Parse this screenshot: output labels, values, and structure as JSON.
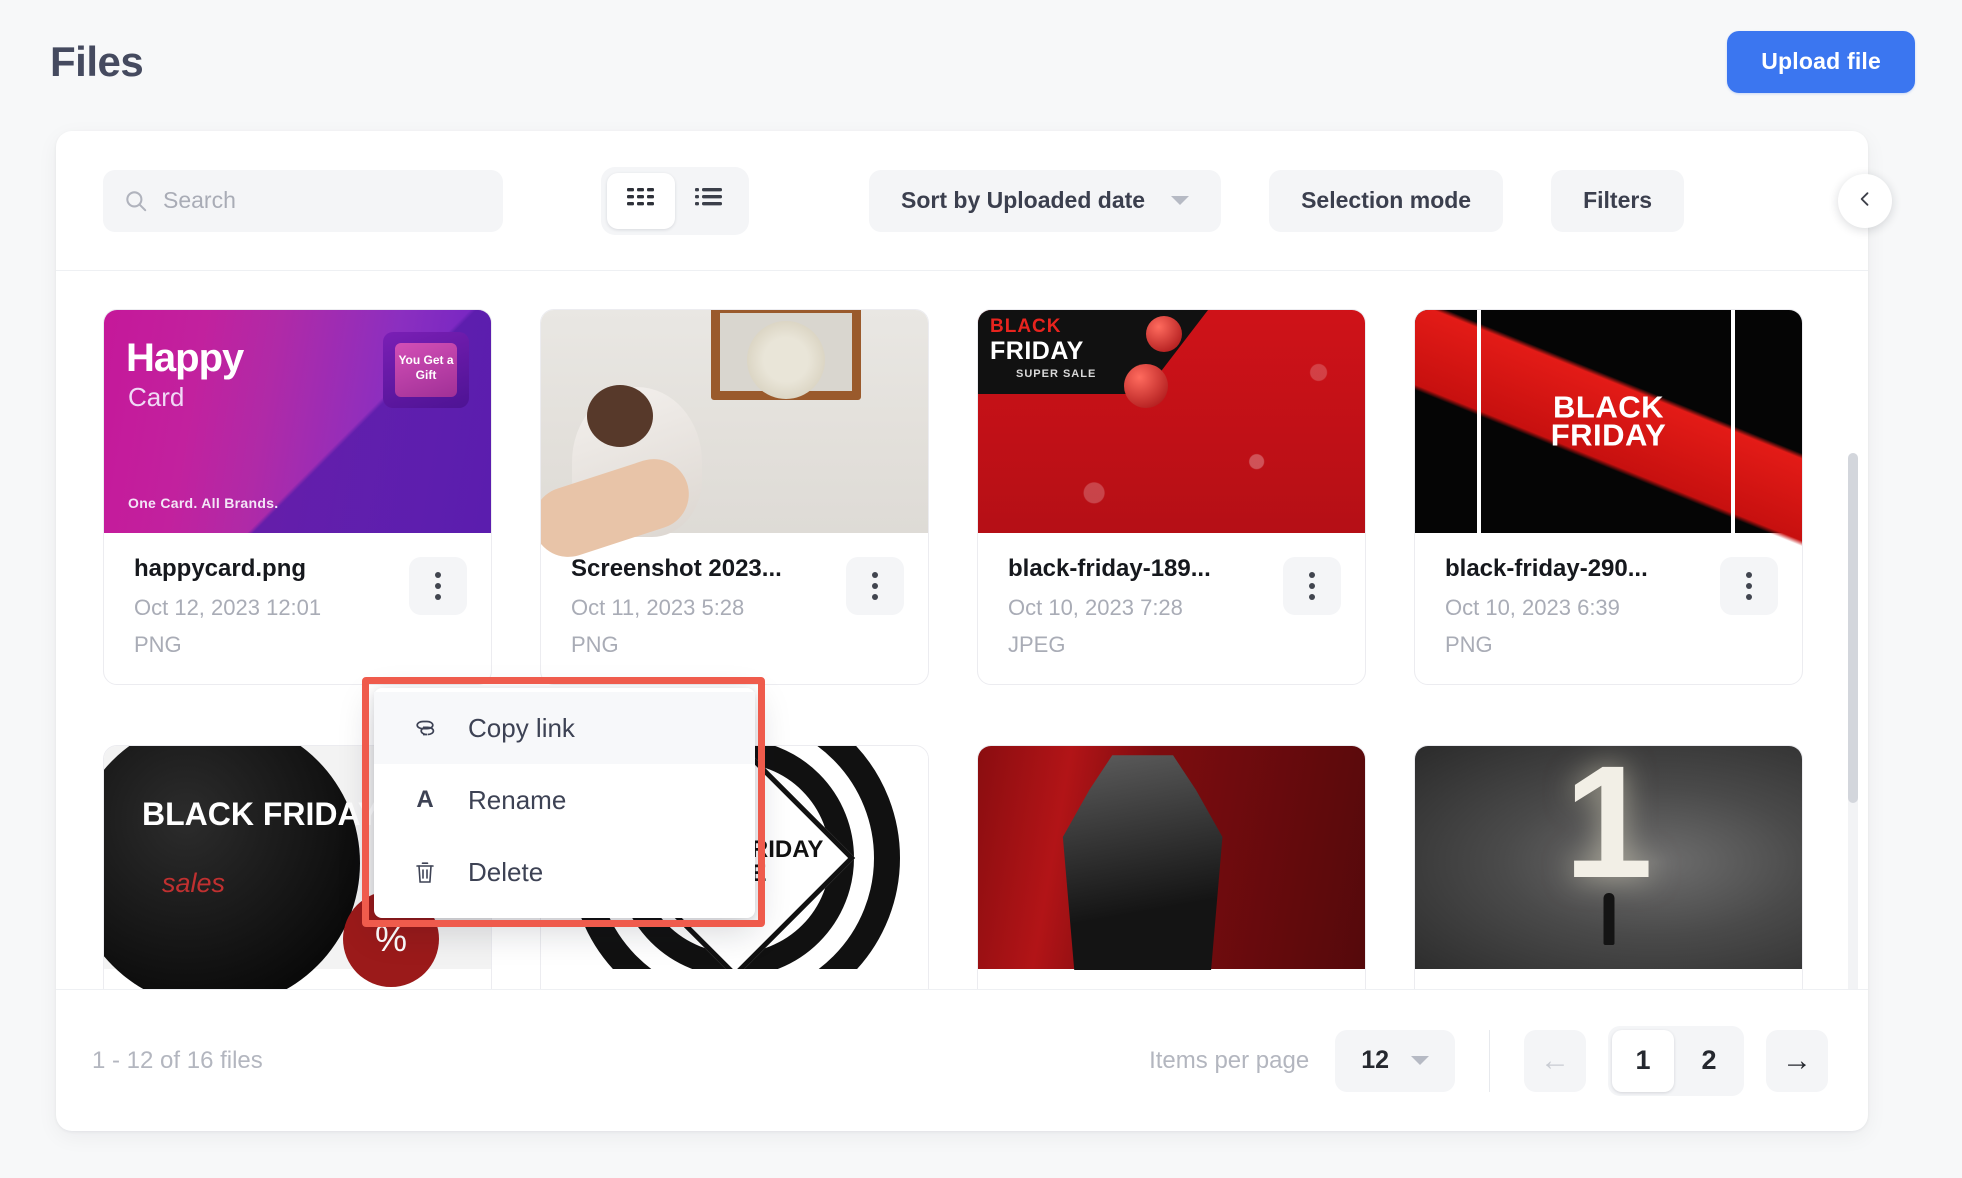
{
  "header": {
    "title": "Files",
    "upload_button": "Upload file"
  },
  "toolbar": {
    "search_placeholder": "Search",
    "search_value": "",
    "view_grid_label": "Grid view",
    "view_list_label": "List view",
    "sort_label": "Sort by Uploaded date",
    "selection_mode_label": "Selection mode",
    "filters_label": "Filters",
    "collapse_label": "Collapse"
  },
  "files": [
    {
      "name": "happycard.png",
      "date": "Oct 12, 2023 12:01",
      "type": "PNG"
    },
    {
      "name": "Screenshot 2023...",
      "date": "Oct 11, 2023 5:28",
      "type": "PNG"
    },
    {
      "name": "black-friday-189...",
      "date": "Oct 10, 2023 7:28",
      "type": "JPEG"
    },
    {
      "name": "black-friday-290...",
      "date": "Oct 10, 2023 6:39",
      "type": "PNG"
    }
  ],
  "thumb_text": {
    "happy_title": "Happy",
    "happy_sub": "Card",
    "happy_tagline": "One Card. All Brands.",
    "gift_text": "You Get a Gift",
    "bf1_top": "BLACK",
    "bf1_mid": "FRIDAY",
    "bf1_small": "SUPER SALE",
    "bf2_text": "BLACK FRIDAY",
    "bf3_text": "BLACK FRIDAY",
    "bf3_sales": "sales",
    "bf3_pct": "%",
    "spiral_text": "BLACK FRIDAY SALE",
    "one_number": "1"
  },
  "context_menu": {
    "items": [
      {
        "label": "Copy link",
        "icon": "link-icon"
      },
      {
        "label": "Rename",
        "icon": "text-format-icon"
      },
      {
        "label": "Delete",
        "icon": "trash-icon"
      }
    ]
  },
  "footer": {
    "count_text": "1 - 12 of 16 files",
    "items_per_page_label": "Items per page",
    "items_per_page_value": "12",
    "prev_arrow": "←",
    "next_arrow": "→",
    "pages": [
      "1",
      "2"
    ],
    "active_page": "1"
  },
  "colors": {
    "accent": "#3b76f0",
    "highlight": "#ef5b4c",
    "title": "#454a5f",
    "muted": "#a9acb6",
    "surface": "#f4f5f7"
  }
}
